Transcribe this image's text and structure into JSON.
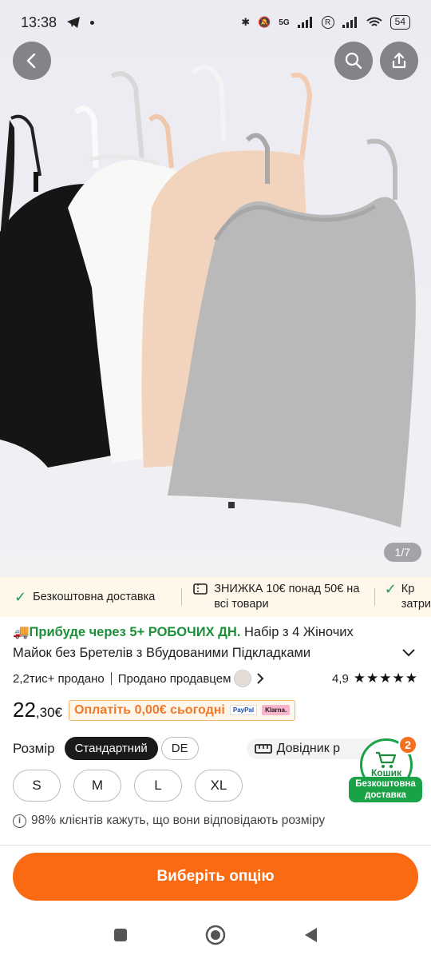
{
  "status": {
    "time": "13:38",
    "battery": "54",
    "network": "5G"
  },
  "gallery": {
    "counter": "1/7"
  },
  "promo": {
    "item1": "Безкоштовна доставка",
    "item2": "ЗНИЖКА 10€ понад 50€ на всі товари",
    "item3_line1": "Кр",
    "item3_line2": "затри"
  },
  "product": {
    "arrival": "Прибуде через 5+ РОБОЧИХ ДН.",
    "title_part1": " Набір з 4 Жіночих",
    "title_part2": "Майок без Бретелів з Вбудованими Підкладками",
    "sold": "2,2тис+ продано",
    "seller": "Продано продавцем",
    "rating": "4,9",
    "stars": "★★★★★",
    "price_int": "22",
    "price_dec": ",30€",
    "pay_today": "Оплатіть 0,00€ сьогодні",
    "paypal": "PayPal",
    "klarna": "Klarna."
  },
  "size": {
    "label": "Розмір",
    "system_active": "Стандартний",
    "system_alt": "DE",
    "guide": "Довідник р",
    "options": [
      "S",
      "M",
      "L",
      "XL"
    ],
    "fit_note": "98% клієнтів кажуть, що вони відповідають розміру"
  },
  "cart": {
    "label": "Кошик",
    "count": "2",
    "free_line1": "Безкоштовна",
    "free_line2": "доставка"
  },
  "cta": {
    "label": "Виберіть опцію"
  },
  "colors": {
    "accent": "#fa6a12",
    "green": "#1aa246",
    "promo_bg": "#fff7ea"
  }
}
